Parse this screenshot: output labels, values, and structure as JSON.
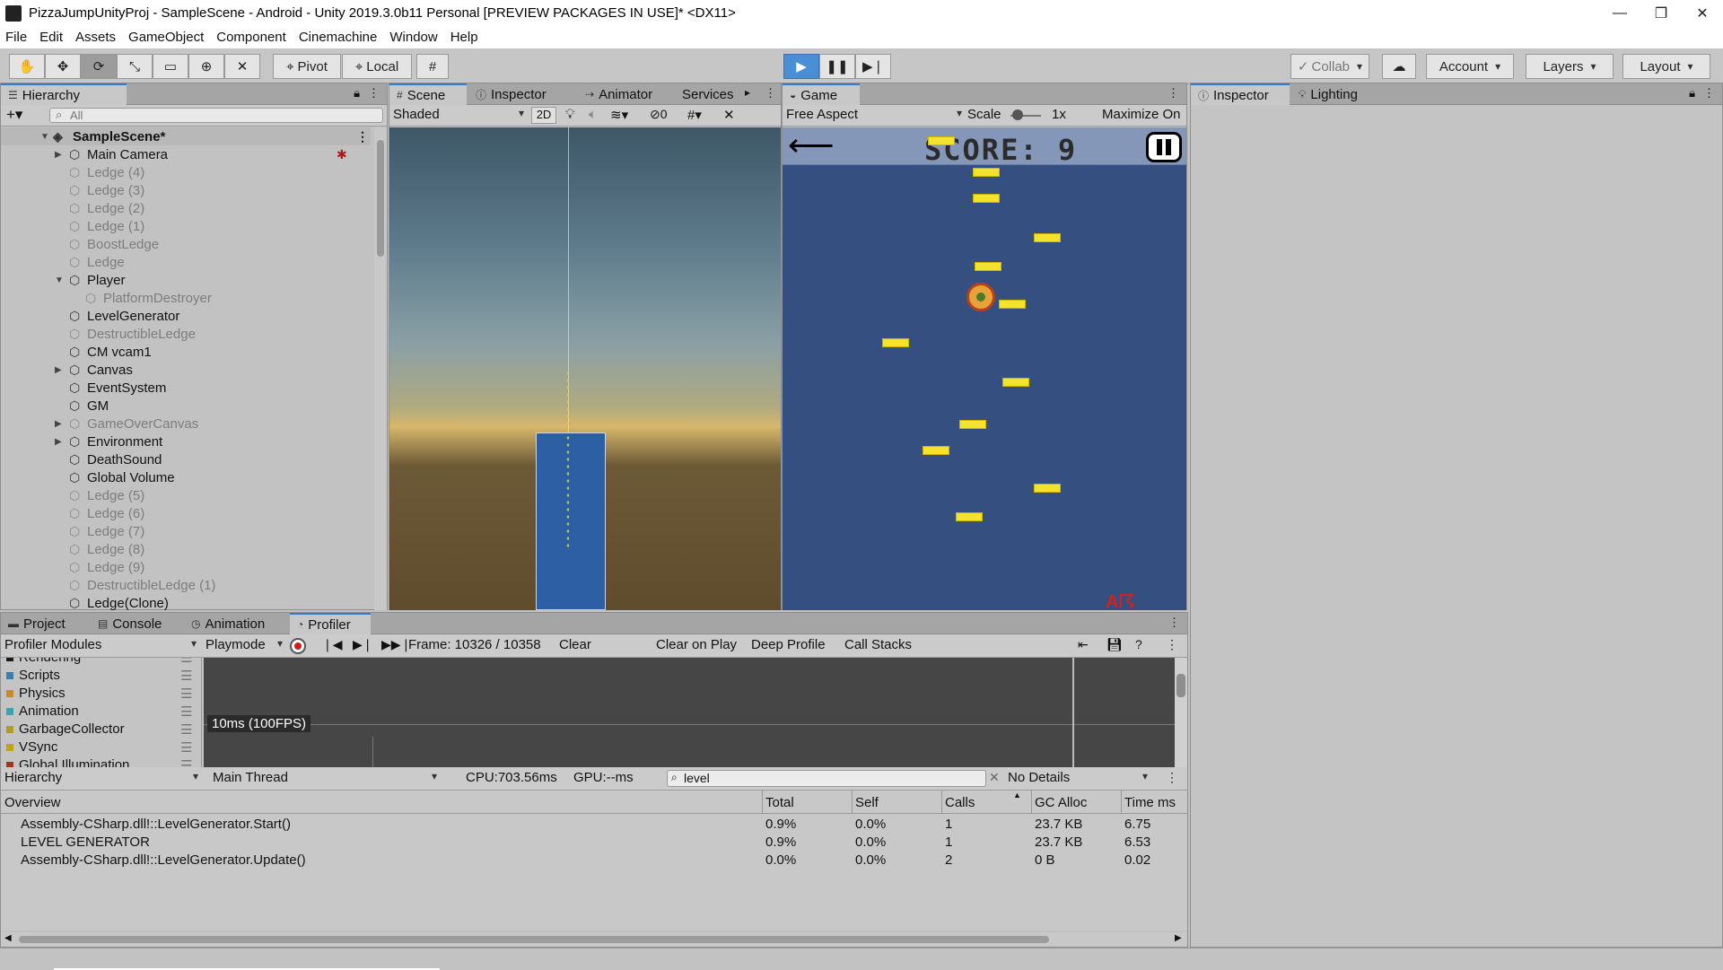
{
  "window": {
    "title": "PizzaJumpUnityProj - SampleScene - Android - Unity 2019.3.0b11 Personal [PREVIEW PACKAGES IN USE]* <DX11>",
    "minimize": "—",
    "maximize": "❐",
    "close": "✕"
  },
  "menu": [
    "File",
    "Edit",
    "Assets",
    "GameObject",
    "Component",
    "Cinemachine",
    "Window",
    "Help"
  ],
  "toolbar": {
    "pivot": "Pivot",
    "local": "Local",
    "collab": "Collab",
    "account": "Account",
    "layers": "Layers",
    "layout": "Layout"
  },
  "hierarchy": {
    "tab": "Hierarchy",
    "search_placeholder": "All",
    "scene": "SampleScene*",
    "items": [
      {
        "label": "Main Camera",
        "dim": false,
        "expand": true,
        "indent": 0
      },
      {
        "label": "Ledge (4)",
        "dim": true,
        "expand": false,
        "indent": 0
      },
      {
        "label": "Ledge (3)",
        "dim": true,
        "expand": false,
        "indent": 0
      },
      {
        "label": "Ledge (2)",
        "dim": true,
        "expand": false,
        "indent": 0
      },
      {
        "label": "Ledge (1)",
        "dim": true,
        "expand": false,
        "indent": 0
      },
      {
        "label": "BoostLedge",
        "dim": true,
        "expand": false,
        "indent": 0
      },
      {
        "label": "Ledge",
        "dim": true,
        "expand": false,
        "indent": 0
      },
      {
        "label": "Player",
        "dim": false,
        "expand": true,
        "indent": 0
      },
      {
        "label": "PlatformDestroyer",
        "dim": true,
        "expand": false,
        "indent": 1
      },
      {
        "label": "LevelGenerator",
        "dim": false,
        "expand": false,
        "indent": 0
      },
      {
        "label": "DestructibleLedge",
        "dim": true,
        "expand": false,
        "indent": 0
      },
      {
        "label": "CM vcam1",
        "dim": false,
        "expand": false,
        "indent": 0
      },
      {
        "label": "Canvas",
        "dim": false,
        "expand": true,
        "indent": 0
      },
      {
        "label": "EventSystem",
        "dim": false,
        "expand": false,
        "indent": 0
      },
      {
        "label": "GM",
        "dim": false,
        "expand": false,
        "indent": 0
      },
      {
        "label": "GameOverCanvas",
        "dim": true,
        "expand": true,
        "indent": 0
      },
      {
        "label": "Environment",
        "dim": false,
        "expand": true,
        "indent": 0
      },
      {
        "label": "DeathSound",
        "dim": false,
        "expand": false,
        "indent": 0
      },
      {
        "label": "Global Volume",
        "dim": false,
        "expand": false,
        "indent": 0
      },
      {
        "label": "Ledge (5)",
        "dim": true,
        "expand": false,
        "indent": 0
      },
      {
        "label": "Ledge (6)",
        "dim": true,
        "expand": false,
        "indent": 0
      },
      {
        "label": "Ledge (7)",
        "dim": true,
        "expand": false,
        "indent": 0
      },
      {
        "label": "Ledge (8)",
        "dim": true,
        "expand": false,
        "indent": 0
      },
      {
        "label": "Ledge (9)",
        "dim": true,
        "expand": false,
        "indent": 0
      },
      {
        "label": "DestructibleLedge (1)",
        "dim": true,
        "expand": false,
        "indent": 0
      },
      {
        "label": "Ledge(Clone)",
        "dim": false,
        "expand": false,
        "indent": 0
      }
    ]
  },
  "scene_tabs": {
    "scene": "Scene",
    "inspector": "Inspector",
    "animator": "Animator",
    "services": "Services",
    "shaded": "Shaded",
    "two_d": "2D",
    "hidden_count": "0"
  },
  "game": {
    "tab": "Game",
    "aspect": "Free Aspect",
    "scale_label": "Scale",
    "scale_value": "1x",
    "maximize": "Maximize On",
    "score": "SCORE: 9"
  },
  "right_tabs": {
    "inspector": "Inspector",
    "lighting": "Lighting"
  },
  "bottom_tabs": {
    "project": "Project",
    "console": "Console",
    "animation": "Animation",
    "profiler": "Profiler"
  },
  "profiler": {
    "modules_dropdown": "Profiler Modules",
    "playmode": "Playmode",
    "frame": "Frame: 10326 / 10358",
    "clear": "Clear",
    "clear_on_play": "Clear on Play",
    "deep_profile": "Deep Profile",
    "call_stacks": "Call Stacks",
    "modules": [
      {
        "name": "Rendering",
        "color": "#1a1a1a"
      },
      {
        "name": "Scripts",
        "color": "#3a7fb0"
      },
      {
        "name": "Physics",
        "color": "#c88a2c"
      },
      {
        "name": "Animation",
        "color": "#3ea0b0"
      },
      {
        "name": "GarbageCollector",
        "color": "#b09a2a"
      },
      {
        "name": "VSync",
        "color": "#c8a020"
      },
      {
        "name": "Global Illumination",
        "color": "#9a3a1a"
      }
    ],
    "graph_label": "10ms (100FPS)",
    "view_mode": "Hierarchy",
    "thread": "Main Thread",
    "cpu": "CPU:703.56ms",
    "gpu": "GPU:--ms",
    "search_value": "level",
    "details": "No Details",
    "columns": [
      "Overview",
      "Total",
      "Self",
      "Calls",
      "GC Alloc",
      "Time ms"
    ],
    "rows": [
      {
        "name": "Assembly-CSharp.dll!::LevelGenerator.Start()",
        "total": "0.9%",
        "self": "0.0%",
        "calls": "1",
        "gc": "23.7 KB",
        "time": "6.75"
      },
      {
        "name": "LEVEL GENERATOR",
        "total": "0.9%",
        "self": "0.0%",
        "calls": "1",
        "gc": "23.7 KB",
        "time": "6.53"
      },
      {
        "name": "Assembly-CSharp.dll!::LevelGenerator.Update()",
        "total": "0.0%",
        "self": "0.0%",
        "calls": "2",
        "gc": "0 B",
        "time": "0.02"
      }
    ]
  }
}
